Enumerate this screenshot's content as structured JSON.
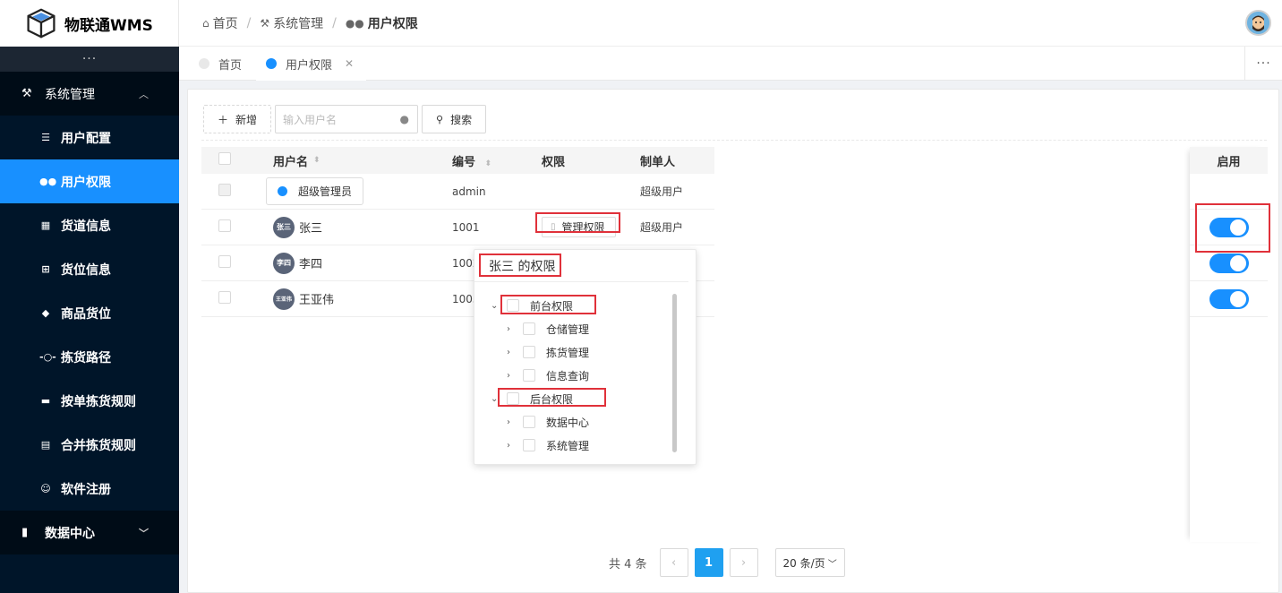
{
  "app": {
    "name": "物联通WMS"
  },
  "sidebar": {
    "collapse_dots": "···",
    "group_system": "系统管理",
    "items": [
      {
        "label": "用户配置",
        "icon": "sliders-icon"
      },
      {
        "label": "用户权限",
        "icon": "users-icon",
        "active": true
      },
      {
        "label": "货道信息",
        "icon": "grid-icon"
      },
      {
        "label": "货位信息",
        "icon": "box-plus-icon"
      },
      {
        "label": "商品货位",
        "icon": "cube-icon"
      },
      {
        "label": "拣货路径",
        "icon": "route-icon"
      },
      {
        "label": "按单拣货规则",
        "icon": "cart-icon"
      },
      {
        "label": "合并拣货规则",
        "icon": "printer-icon"
      },
      {
        "label": "软件注册",
        "icon": "smile-icon"
      }
    ],
    "group_data": "数据中心"
  },
  "header": {
    "crumbs": [
      "首页",
      "系统管理",
      "用户权限"
    ]
  },
  "tabs": {
    "items": [
      {
        "label": "首页"
      },
      {
        "label": "用户权限",
        "closable": true
      }
    ],
    "more": "···"
  },
  "toolbar": {
    "add_label": "新增",
    "search_placeholder": "输入用户名",
    "search_label": "搜索"
  },
  "table": {
    "columns": [
      "用户名",
      "编号",
      "权限",
      "制单人",
      "启用"
    ],
    "rows": [
      {
        "name": "超级管理员",
        "avatar": "",
        "code": "admin",
        "perm": "",
        "maker": "超级用户",
        "enabled": null
      },
      {
        "name": "张三",
        "avatar": "张三",
        "code": "1001",
        "perm": "管理权限",
        "maker": "超级用户",
        "enabled": true
      },
      {
        "name": "李四",
        "avatar": "李四",
        "code": "1002",
        "perm": "",
        "maker": "",
        "enabled": true
      },
      {
        "name": "王亚伟",
        "avatar": "王亚伟",
        "code": "1003",
        "perm": "",
        "maker": "",
        "enabled": true
      }
    ]
  },
  "popover": {
    "title": "张三 的权限",
    "tree": [
      {
        "label": "前台权限",
        "expanded": true,
        "children": [
          "仓储管理",
          "拣货管理",
          "信息查询"
        ]
      },
      {
        "label": "后台权限",
        "expanded": true,
        "children": [
          "数据中心",
          "系统管理"
        ]
      }
    ]
  },
  "pagination": {
    "total_text": "共 4 条",
    "current_page": "1",
    "page_size": "20 条/页",
    "prev": "‹",
    "next": "›"
  },
  "colors": {
    "primary": "#1890ff",
    "sidebar_bg": "#001529",
    "highlight_red": "#e0313a"
  }
}
